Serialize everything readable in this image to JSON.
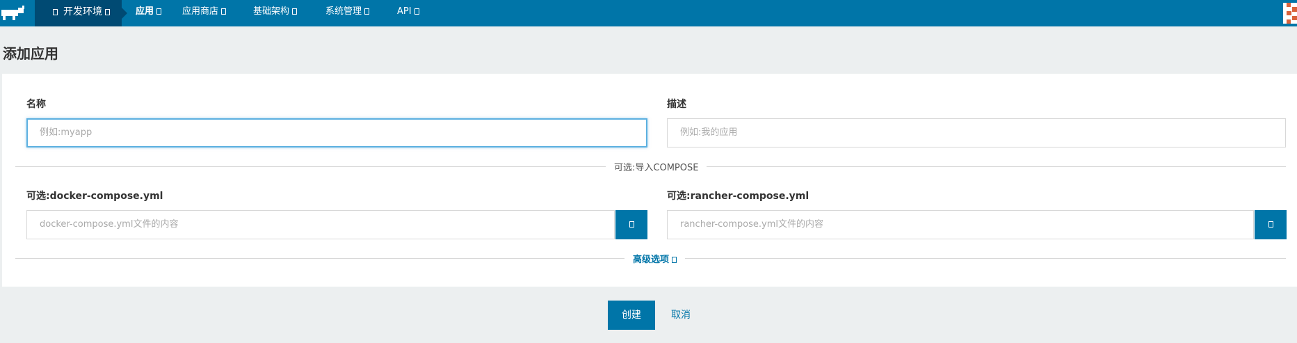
{
  "nav": {
    "environment": "开发环境",
    "items": [
      {
        "label": "应用",
        "active": true
      },
      {
        "label": "应用商店",
        "active": false
      },
      {
        "label": "基础架构",
        "active": false
      },
      {
        "label": "系统管理",
        "active": false
      },
      {
        "label": "API",
        "active": false
      }
    ]
  },
  "page": {
    "title": "添加应用"
  },
  "form": {
    "name_label": "名称",
    "name_placeholder": "例如:myapp",
    "description_label": "描述",
    "description_placeholder": "例如:我的应用",
    "compose_divider": "可选:导入COMPOSE",
    "docker_compose_label": "可选:docker-compose.yml",
    "docker_compose_placeholder": "docker-compose.yml文件的内容",
    "rancher_compose_label": "可选:rancher-compose.yml",
    "rancher_compose_placeholder": "rancher-compose.yml文件的内容",
    "advanced_label": "高级选项"
  },
  "actions": {
    "create": "创建",
    "cancel": "取消"
  },
  "colors": {
    "primary": "#0075a8",
    "env_bg": "#004a73",
    "page_bg": "#eceff0"
  }
}
